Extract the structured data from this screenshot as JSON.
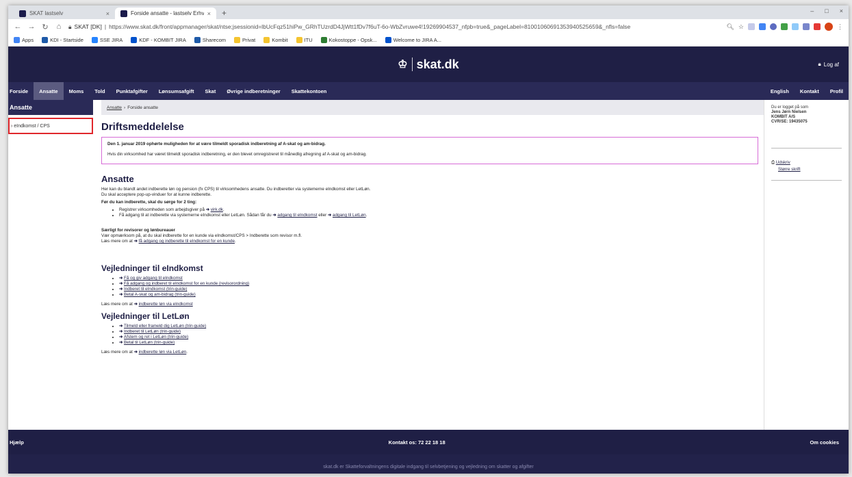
{
  "browser": {
    "tabs": [
      {
        "title": "SKAT lastselv",
        "close": "×"
      },
      {
        "title": "Forside ansatte - lastselv Erhverv",
        "close": "×"
      }
    ],
    "new_tab": "+",
    "window_controls": [
      "–",
      "□",
      "×"
    ],
    "site_badge": "SKAT [DK]",
    "url": "https://www.skat.dk/front/appmanager/skat/ntse;jsessionid=lbUcFqz51hiPw_GRhTUzrdD4JjWtt1fDv7f6uT-6o-WbZvruwe4!19269904537_nfpb=true&_pageLabel=81001060691353940525659&_nfls=false",
    "bookmarks": [
      {
        "label": "Apps",
        "color": "#4285f4"
      },
      {
        "label": "KDI - Startside",
        "color": "#1e5aa8"
      },
      {
        "label": "SSE JIRA",
        "color": "#2684ff"
      },
      {
        "label": "KDF - KOMBIT JIRA",
        "color": "#0052cc"
      },
      {
        "label": "Sharecom",
        "color": "#1e5aa8"
      },
      {
        "label": "Privat",
        "color": "#f4c430"
      },
      {
        "label": "Kombit",
        "color": "#f4c430"
      },
      {
        "label": "ITU",
        "color": "#f4c430"
      },
      {
        "label": "Kokostoppe - Opsk...",
        "color": "#2e7d32"
      },
      {
        "label": "Welcome to JIRA A...",
        "color": "#0052cc"
      }
    ]
  },
  "header": {
    "logo_text": "skat.dk",
    "logout": "Log af"
  },
  "nav": {
    "left": [
      "Forside",
      "Ansatte",
      "Moms",
      "Told",
      "Punktafgifter",
      "Lønsumsafgift",
      "Skat",
      "Øvrige indberetninger",
      "Skattekontoen"
    ],
    "right": [
      "English",
      "Kontakt",
      "Profil"
    ],
    "active_index": 1
  },
  "left": {
    "heading": "Ansatte",
    "item": "› eIndkomst / CPS"
  },
  "breadcrumb": {
    "link": "Ansatte",
    "sep": "›",
    "current": "Forside ansatte"
  },
  "main": {
    "drift_title": "Driftsmeddelelse",
    "notice_title": "Den 1. januar 2019 ophørte muligheden for at være tilmeldt sporadisk indberetning af A-skat og am-bidrag.",
    "notice_text": "Hvis din virksomhed har været tilmeldt sporadisk indberetning, er den blevet omregistreret til månedlig afregning af A-skat og am-bidrag.",
    "ansatte_title": "Ansatte",
    "intro1": "Her kan du blandt andet indberette løn og pension (fx CPS) til virksomhedens ansatte. Du indberetter via systemerne eIndkomst eller LetLøn.",
    "intro2": "Du skal acceptere pop-up-vinduer for at kunne indberette.",
    "before_title": "Før du kan indberette, skal du sørge for 2 ting:",
    "b1_text": "Registrer virksomheden som arbejdsgiver på",
    "b1_link": "virk.dk",
    "b2_text": "Få adgang til at indberette via systemerne eIndkomst eller LetLøn. Sådan får du",
    "b2_link1": "adgang til eIndkomst",
    "b2_or": "eller",
    "b2_link2": "adgang til LetLøn",
    "revisor_title": "Særligt for revisorer og lønbureauer",
    "revisor_text": "Vær opmærksom på, at du skal indberette for en kunde via eIndkomst/CPS > Indberette som revisor m.fl.",
    "revisor_more": "Læs mere om at",
    "revisor_link": "få adgang og indberette til eIndkomst for en kunde",
    "vej1_title": "Vejledninger til eIndkomst",
    "vej1_items": [
      "Få og giv adgang til eIndkomst",
      "Få adgang og indberet til eIndkomst for en kunde (revisorordning)",
      "Indberet til eIndkomst (trin-guide)",
      "Betal A-skat og am-bidrag (trin-guide)"
    ],
    "vej1_more": "Læs mere om at",
    "vej1_more_link": "indberette løn via eIndkomst",
    "vej2_title": "Vejledninger til LetLøn",
    "vej2_items": [
      "Tilmeld eller frameld dig LetLøn (trin-guide)",
      "Indberet til LetLøn (trin-guide)",
      "Afstem og ret i LetLøn (trin-guide)",
      "Betal til LetLøn (trin-guide)"
    ],
    "vej2_more": "Læs mere om at",
    "vej2_more_link": "indberette løn via LetLøn"
  },
  "right": {
    "logged_in": "Du er logget på som",
    "name": "Jens Jørn Nielsen",
    "company": "KOMBIT A/S",
    "cvr": "CVR/SE: 19435075",
    "print": "Udskriv",
    "bigger": "Større skrift"
  },
  "footer": {
    "help": "Hjælp",
    "contact": "Kontakt os: 72 22 18 18",
    "cookies": "Om cookies",
    "tagline": "skat.dk er Skatteforvaltningens digitale indgang til selvbetjening og vejledning om skatter og afgifter"
  }
}
